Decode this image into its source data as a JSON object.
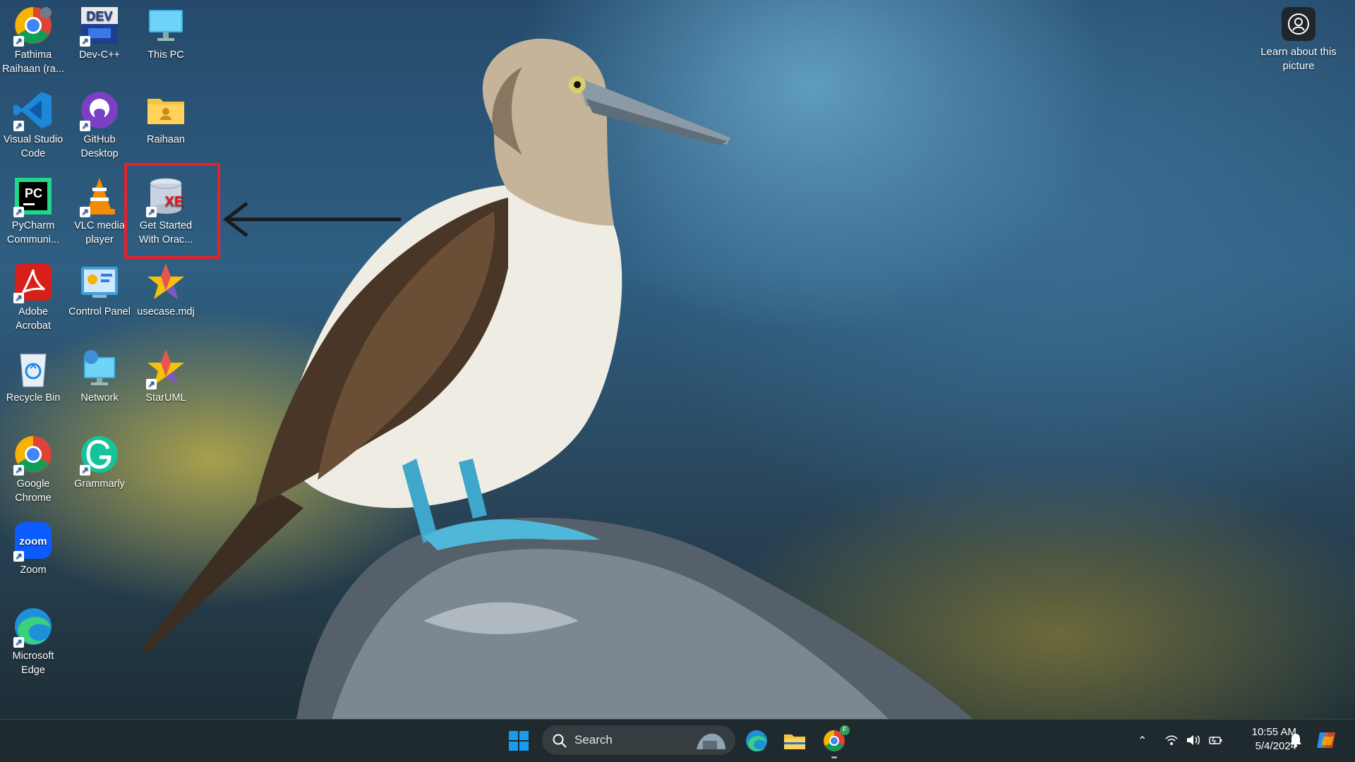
{
  "desktop": {
    "icons": [
      {
        "label": "Fathima Raihaan (ra...",
        "name": "chrome-profile-icon"
      },
      {
        "label": "Dev-C++",
        "name": "devcpp-icon"
      },
      {
        "label": "This PC",
        "name": "this-pc-icon"
      },
      {
        "label": "Visual Studio Code",
        "name": "vscode-icon"
      },
      {
        "label": "GitHub Desktop",
        "name": "github-desktop-icon"
      },
      {
        "label": "Raihaan",
        "name": "user-folder-icon"
      },
      {
        "label": "PyCharm Communi...",
        "name": "pycharm-icon"
      },
      {
        "label": "VLC media player",
        "name": "vlc-icon"
      },
      {
        "label": "Get Started With Orac...",
        "name": "oracle-xe-icon"
      },
      {
        "label": "Adobe Acrobat",
        "name": "adobe-acrobat-icon"
      },
      {
        "label": "Control Panel",
        "name": "control-panel-icon"
      },
      {
        "label": "usecase.mdj",
        "name": "staruml-file-icon"
      },
      {
        "label": "Recycle Bin",
        "name": "recycle-bin-icon"
      },
      {
        "label": "Network",
        "name": "network-icon"
      },
      {
        "label": "StarUML",
        "name": "staruml-icon"
      },
      {
        "label": "Google Chrome",
        "name": "google-chrome-icon"
      },
      {
        "label": "Grammarly",
        "name": "grammarly-icon"
      },
      {
        "label": "Zoom",
        "name": "zoom-icon"
      },
      {
        "label": "Microsoft Edge",
        "name": "microsoft-edge-icon"
      }
    ],
    "learn_label": "Learn about this picture",
    "dev_text": "DEV",
    "pc_text": "PC",
    "xe_text": "XE",
    "zoom_text": "zoom"
  },
  "taskbar": {
    "search_label": "Search",
    "time": "10:55 AM",
    "date": "5/4/2024",
    "chrome_badge": "F"
  },
  "colors": {
    "highlight": "#e8202b",
    "taskbar_bg": "#1f2a2e",
    "windows_blue": "#1a9bf0"
  }
}
